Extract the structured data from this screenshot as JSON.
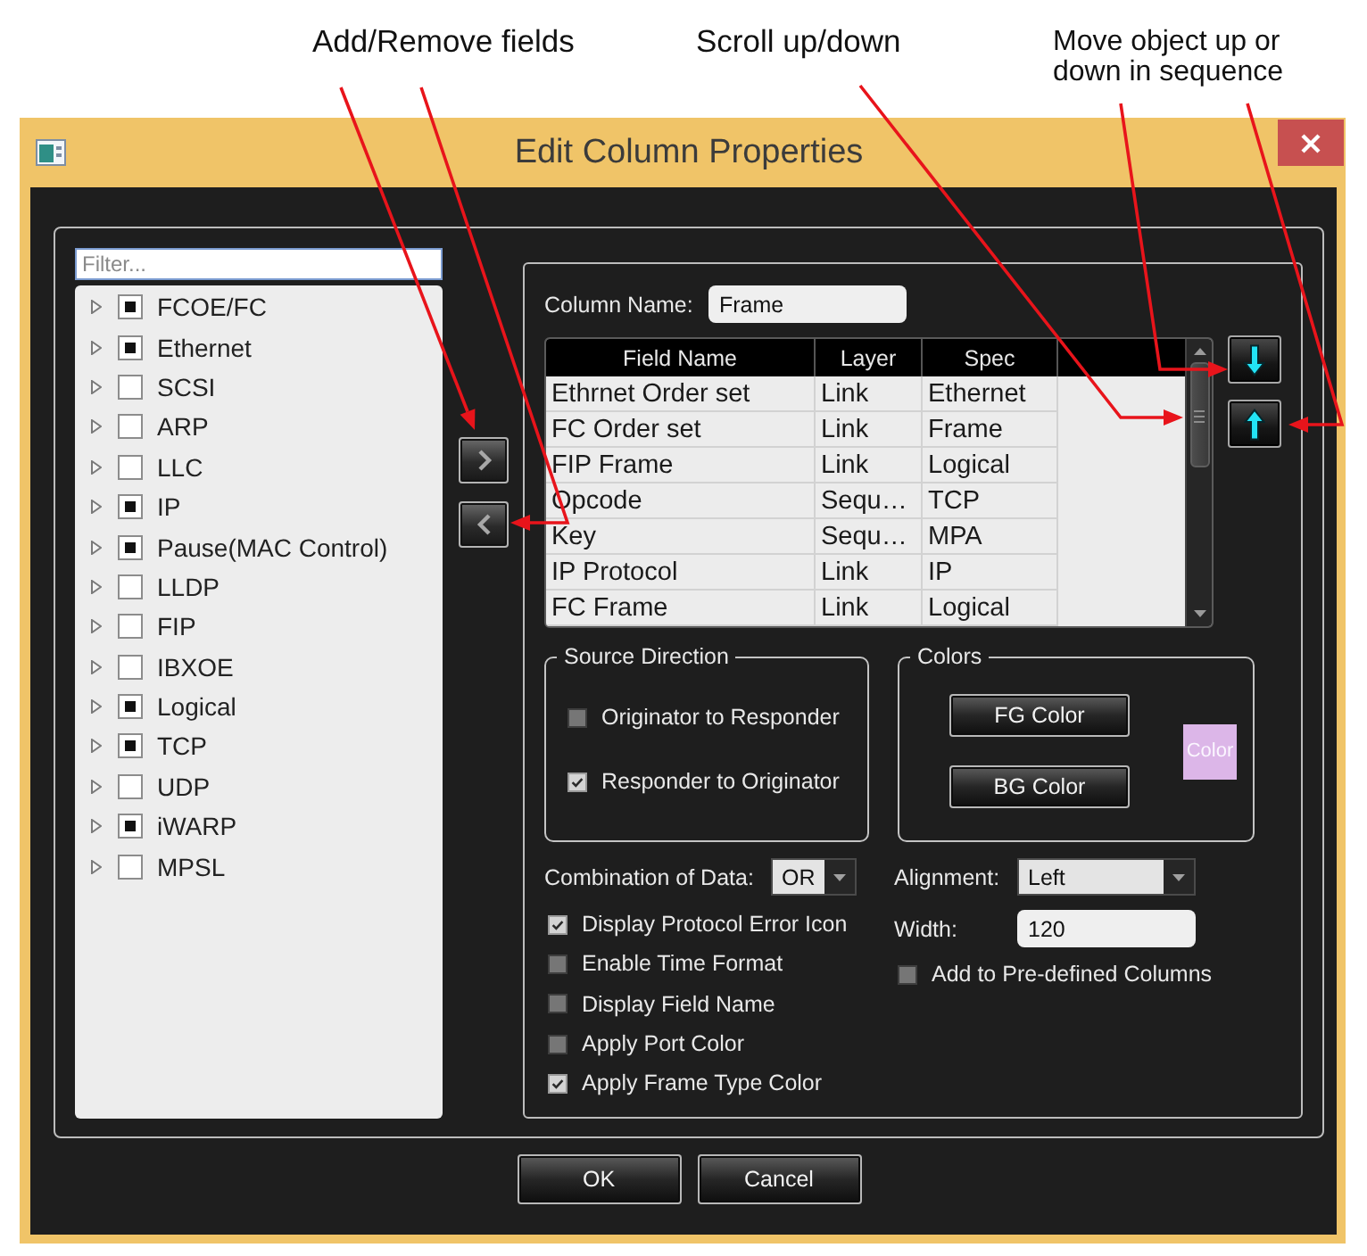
{
  "annotations": [
    {
      "text": "Add/Remove fields"
    },
    {
      "text": "Scroll up/down"
    },
    {
      "text": "Move object up or down in sequence"
    }
  ],
  "window": {
    "title": "Edit Column Properties"
  },
  "filter": {
    "placeholder": "Filter..."
  },
  "protocols": [
    {
      "label": "FCOE/FC",
      "checked": true,
      "expanded": false
    },
    {
      "label": "Ethernet",
      "checked": true,
      "expanded": false
    },
    {
      "label": "SCSI",
      "checked": false,
      "expanded": false
    },
    {
      "label": "ARP",
      "checked": false,
      "expanded": false
    },
    {
      "label": "LLC",
      "checked": false,
      "expanded": false
    },
    {
      "label": "IP",
      "checked": true,
      "expanded": false
    },
    {
      "label": "Pause(MAC Control)",
      "checked": true,
      "expanded": false
    },
    {
      "label": "LLDP",
      "checked": false,
      "expanded": false
    },
    {
      "label": "FIP",
      "checked": false,
      "expanded": false
    },
    {
      "label": "IBXOE",
      "checked": false,
      "expanded": false
    },
    {
      "label": "Logical",
      "checked": true,
      "expanded": false
    },
    {
      "label": "TCP",
      "checked": true,
      "expanded": false
    },
    {
      "label": "UDP",
      "checked": false,
      "expanded": false
    },
    {
      "label": "iWARP",
      "checked": true,
      "expanded": false
    },
    {
      "label": "MPSL",
      "checked": false,
      "expanded": false
    }
  ],
  "column_name": {
    "label": "Column Name:",
    "value": "Frame"
  },
  "fields_table": {
    "columns": [
      "Field Name",
      "Layer",
      "Spec"
    ],
    "rows": [
      [
        "Ethrnet Order set",
        "Link",
        "Ethernet"
      ],
      [
        "FC Order set",
        "Link",
        "Frame"
      ],
      [
        "FIP Frame",
        "Link",
        "Logical"
      ],
      [
        "Opcode",
        "Sequ…",
        "TCP"
      ],
      [
        "Key",
        "Sequ…",
        "MPA"
      ],
      [
        "IP Protocol",
        "Link",
        "IP"
      ],
      [
        "FC Frame",
        "Link",
        "Logical"
      ]
    ]
  },
  "source_direction": {
    "title": "Source Direction",
    "options": [
      {
        "label": "Originator to Responder",
        "checked": false
      },
      {
        "label": "Responder to Originator",
        "checked": true
      }
    ]
  },
  "colors": {
    "title": "Colors",
    "buttons": [
      "FG Color",
      "BG Color"
    ],
    "swatch": {
      "label": "Color",
      "color": "#dcb6e8"
    }
  },
  "combination": {
    "label": "Combination of Data:",
    "value": "OR"
  },
  "options": [
    {
      "label": "Display Protocol Error Icon",
      "checked": true
    },
    {
      "label": "Enable Time Format",
      "checked": false
    },
    {
      "label": "Display Field Name",
      "checked": false
    },
    {
      "label": "Apply Port Color",
      "checked": false
    },
    {
      "label": "Apply Frame Type Color",
      "checked": true
    }
  ],
  "alignment": {
    "label": "Alignment:",
    "value": "Left"
  },
  "width": {
    "label": "Width:",
    "value": "120"
  },
  "predefined": {
    "label": "Add to Pre-defined Columns",
    "checked": false
  },
  "buttons": [
    "OK",
    "Cancel"
  ]
}
